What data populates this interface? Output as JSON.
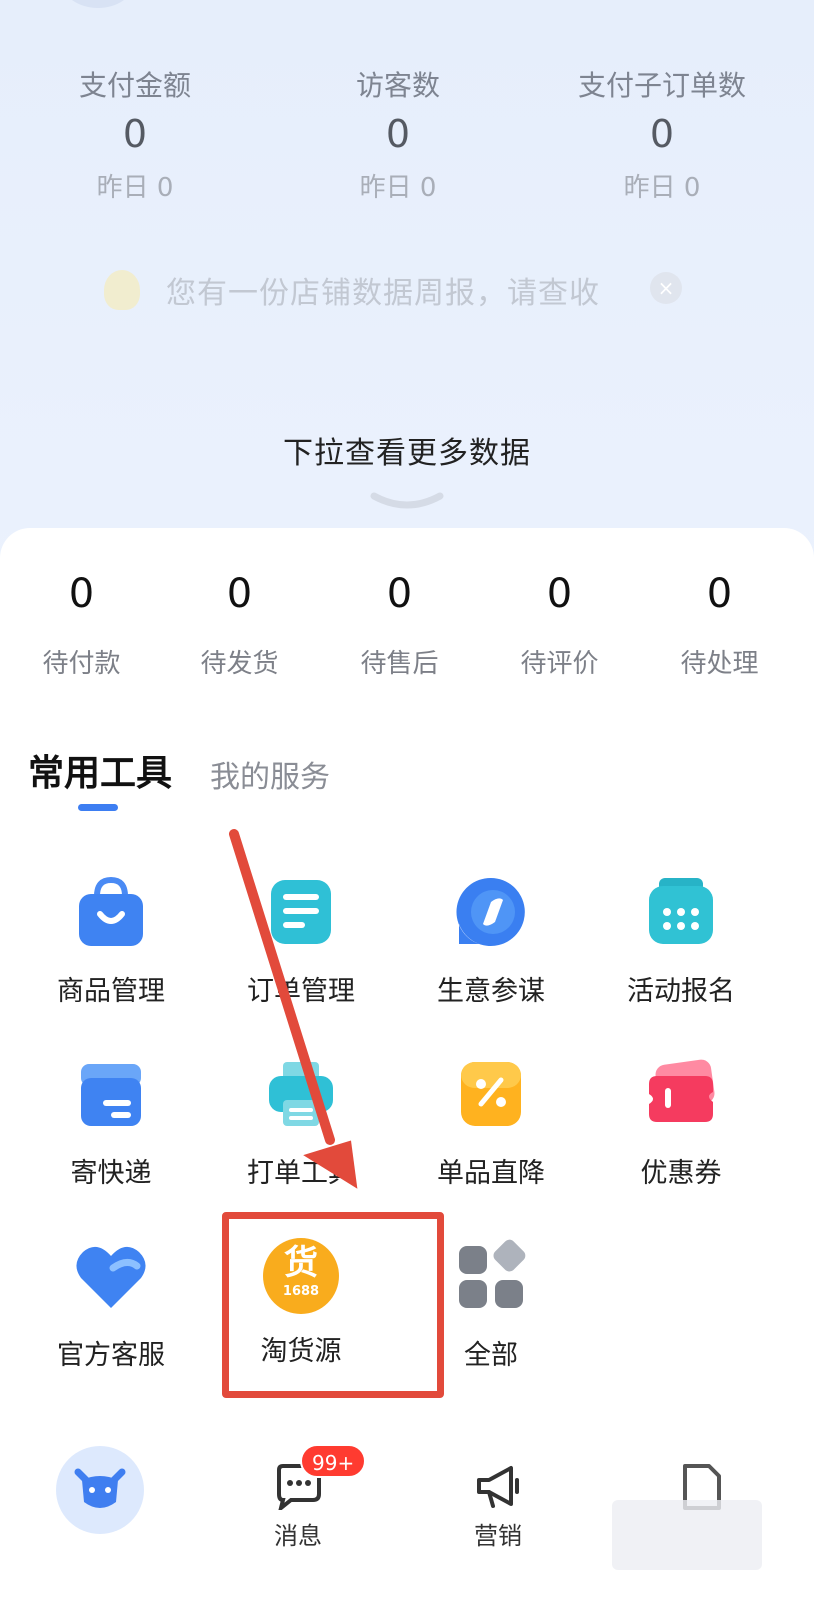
{
  "stats": [
    {
      "label": "支付金额",
      "value": "0",
      "sub": "昨日 0"
    },
    {
      "label": "访客数",
      "value": "0",
      "sub": "昨日 0"
    },
    {
      "label": "支付子订单数",
      "value": "0",
      "sub": "昨日 0"
    }
  ],
  "notice": {
    "text": "您有一份店铺数据周报，请查收",
    "close": "×"
  },
  "pull": {
    "text": "下拉查看更多数据"
  },
  "orders": [
    {
      "num": "0",
      "label": "待付款"
    },
    {
      "num": "0",
      "label": "待发货"
    },
    {
      "num": "0",
      "label": "待售后"
    },
    {
      "num": "0",
      "label": "待评价"
    },
    {
      "num": "0",
      "label": "待处理"
    }
  ],
  "tabs": {
    "active": "常用工具",
    "inactive": "我的服务"
  },
  "tools": [
    {
      "label": "商品管理",
      "icon": "shopping-bag-icon"
    },
    {
      "label": "订单管理",
      "icon": "order-list-icon"
    },
    {
      "label": "生意参谋",
      "icon": "compass-icon"
    },
    {
      "label": "活动报名",
      "icon": "calendar-icon"
    },
    {
      "label": "寄快递",
      "icon": "parcel-box-icon"
    },
    {
      "label": "打单工具",
      "icon": "printer-icon"
    },
    {
      "label": "单品直降",
      "icon": "discount-tag-icon"
    },
    {
      "label": "优惠券",
      "icon": "coupon-icon"
    },
    {
      "label": "官方客服",
      "icon": "heart-icon"
    },
    {
      "label": "淘货源",
      "icon": "1688-coin-icon",
      "icon_text": "货",
      "icon_sub": "1688"
    },
    {
      "label": "全部",
      "icon": "grid-icon"
    }
  ],
  "nav": {
    "messages_label": "消息",
    "messages_badge": "99+",
    "marketing_label": "营销"
  },
  "colors": {
    "accent": "#3d7ef2",
    "annotation_red": "#e24a3b",
    "badge_red": "#ff3b30"
  }
}
